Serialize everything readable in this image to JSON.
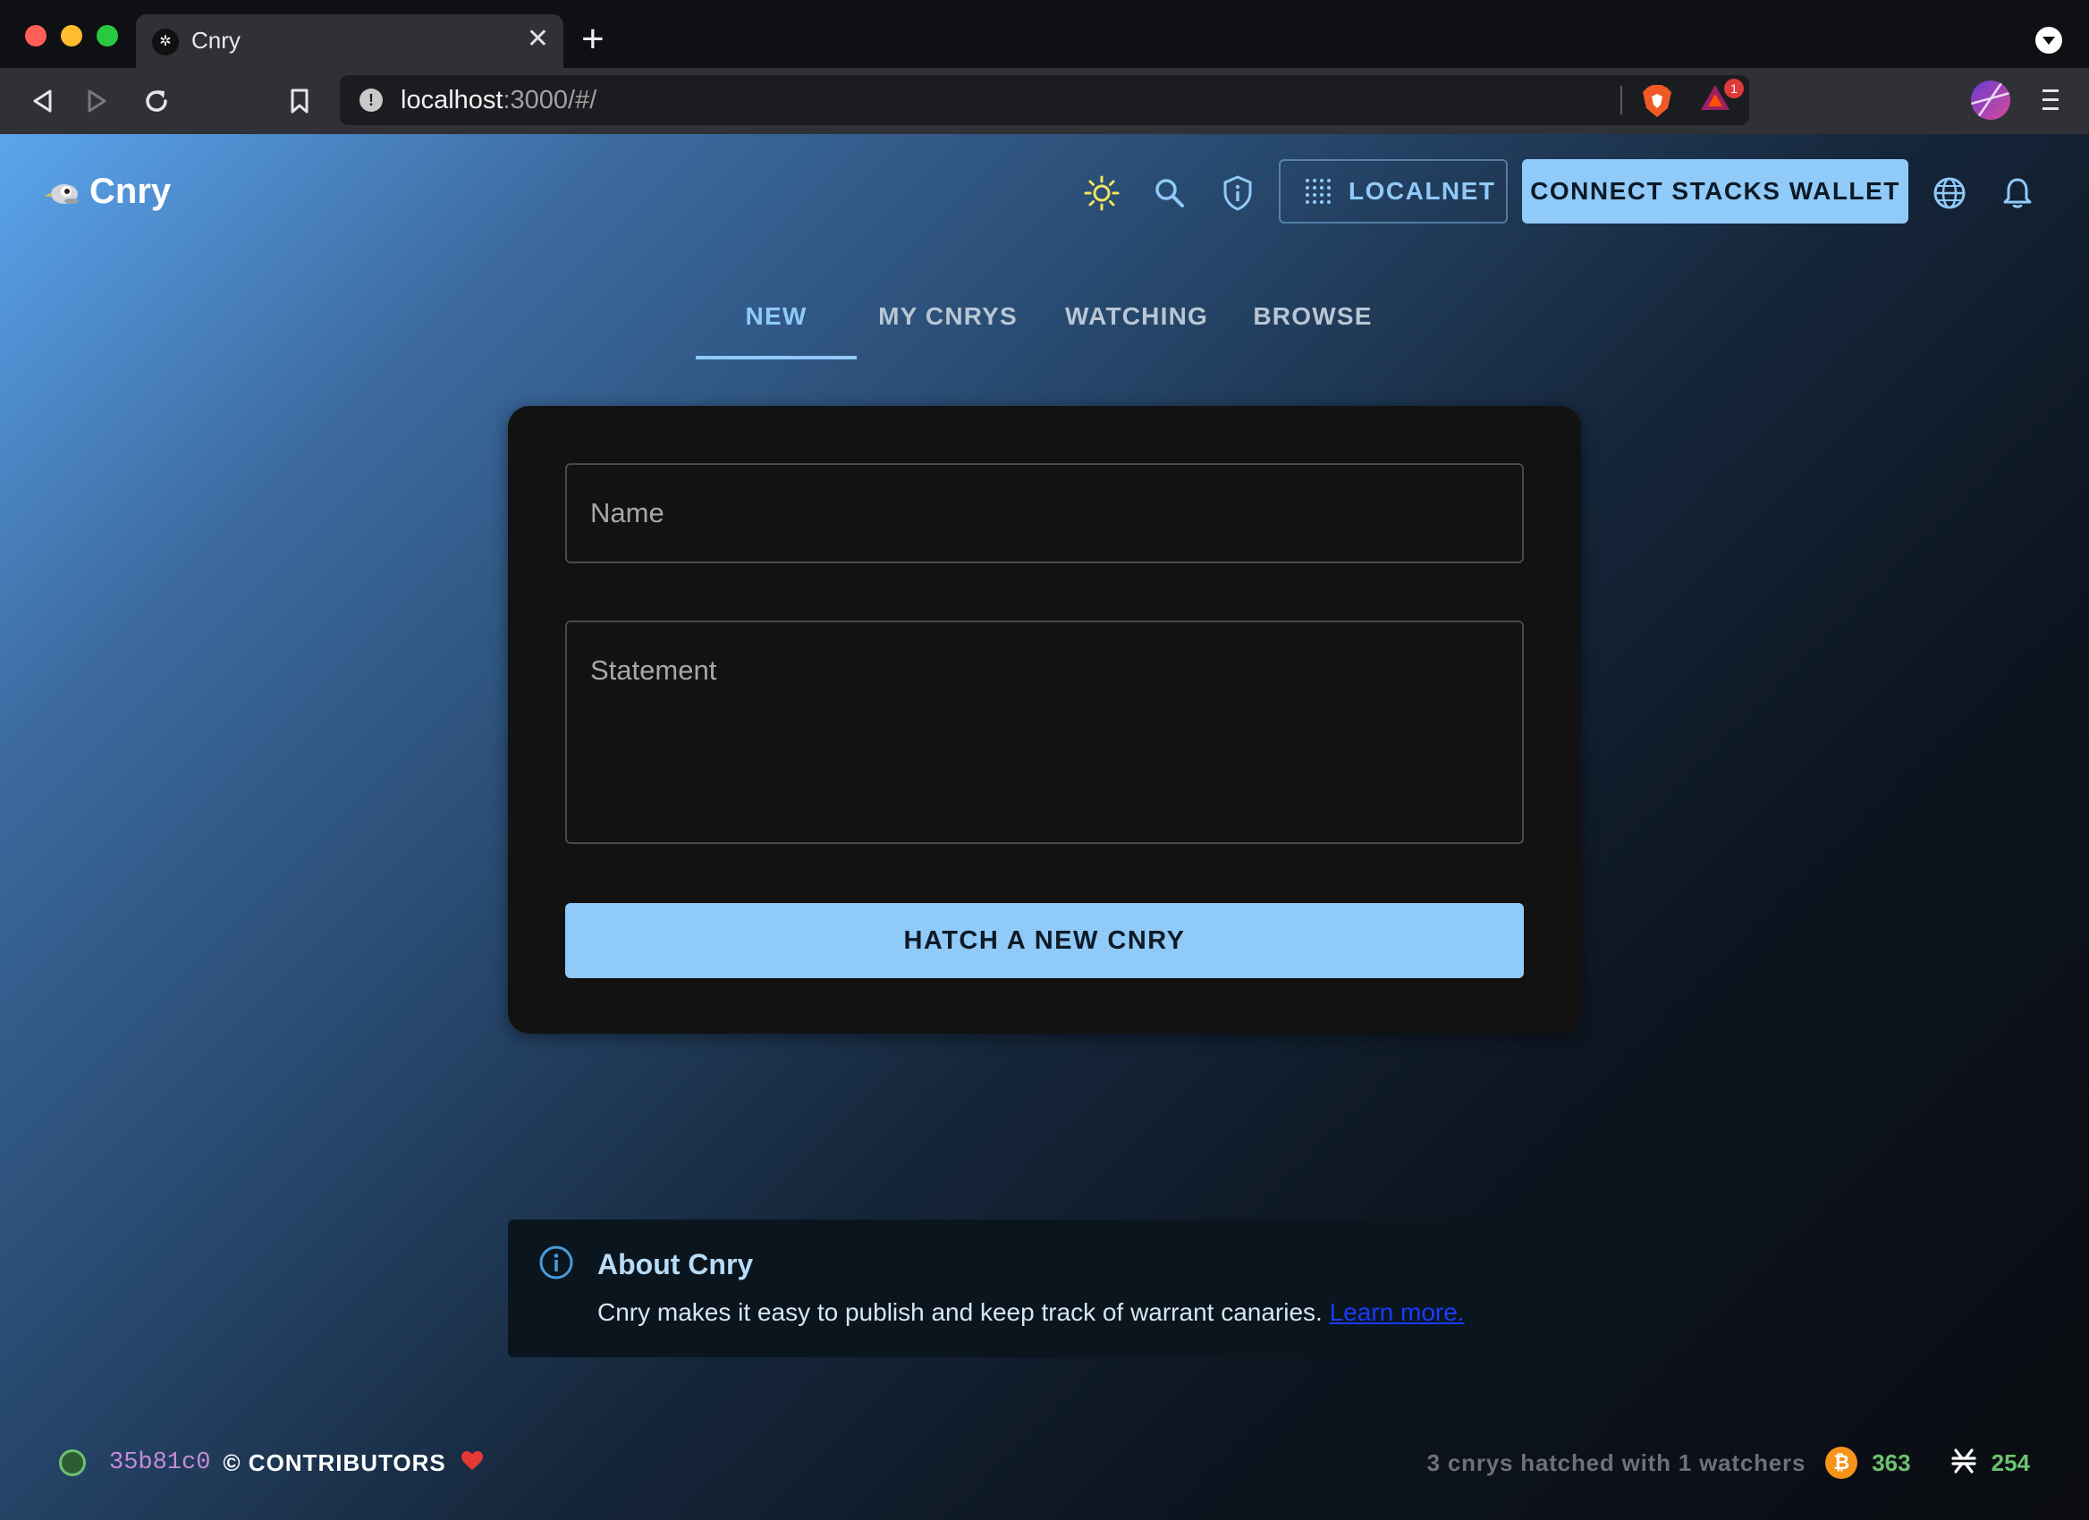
{
  "browser": {
    "tab_title": "Cnry",
    "tab_favicon": "✲",
    "close_glyph": "✕",
    "new_tab_glyph": "+",
    "url_host": "localhost",
    "url_path": ":3000/#/",
    "url_info_glyph": "!",
    "extension_badge": "1"
  },
  "app": {
    "brand": "Cnry",
    "network_button": "LOCALNET",
    "wallet_button": "CONNECT STACKS WALLET",
    "tabs": [
      {
        "label": "NEW",
        "active": true
      },
      {
        "label": "MY CNRYS",
        "active": false
      },
      {
        "label": "WATCHING",
        "active": false
      },
      {
        "label": "BROWSE",
        "active": false
      }
    ],
    "form": {
      "name_placeholder": "Name",
      "statement_placeholder": "Statement",
      "submit_label": "HATCH A NEW CNRY"
    },
    "about": {
      "title": "About Cnry",
      "body": "Cnry makes it easy to publish and keep track of warrant canaries.",
      "link": "Learn more."
    },
    "footer": {
      "commit": "35b81c0",
      "contributors": "© CONTRIBUTORS",
      "stats": "3 cnrys hatched with 1 watchers",
      "btc_glyph": "₿",
      "btc_block": "363",
      "stx_block": "254"
    },
    "colors": {
      "accent": "#90caf9",
      "card": "#121212",
      "status_green": "#6cc26f",
      "commit_purple": "#c58bd8",
      "heart": "#e53935"
    },
    "icons": [
      "theme-sun-icon",
      "search-icon",
      "shield-icon",
      "network-dots-icon",
      "globe-icon",
      "bell-icon",
      "info-icon",
      "heart-icon",
      "bitcoin-icon",
      "stacks-icon"
    ]
  }
}
